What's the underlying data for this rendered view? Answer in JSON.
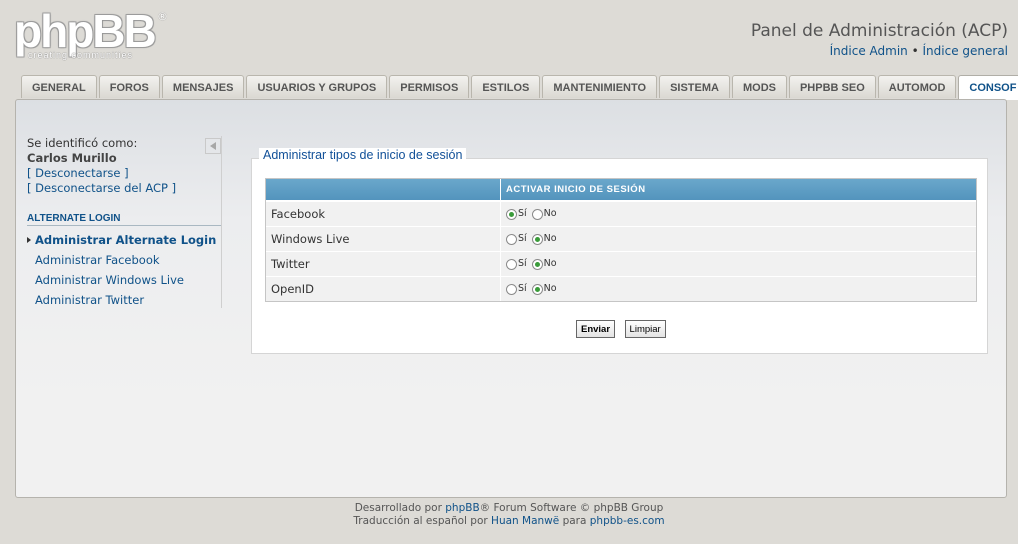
{
  "header": {
    "logo_text": "phpBB",
    "logo_reg": "®",
    "logo_tagline": "creating communities",
    "title": "Panel de Administración (ACP)",
    "link_admin": "Índice Admin",
    "separator": "•",
    "link_general": "Índice general"
  },
  "tabs": [
    {
      "label": "GENERAL"
    },
    {
      "label": "FOROS"
    },
    {
      "label": "MENSAJES"
    },
    {
      "label": "USUARIOS Y GRUPOS"
    },
    {
      "label": "PERMISOS"
    },
    {
      "label": "ESTILOS"
    },
    {
      "label": "MANTENIMIENTO"
    },
    {
      "label": "SISTEMA"
    },
    {
      "label": "MODS"
    },
    {
      "label": "PHPBB SEO"
    },
    {
      "label": "AUTOMOD"
    },
    {
      "label": "CONSOF",
      "active": true
    }
  ],
  "sidebar": {
    "identified_as": "Se identificó como:",
    "username": "Carlos Murillo",
    "logout": "[ Desconectarse ]",
    "logout_acp": "[ Desconectarse del ACP ]",
    "section_title": "ALTERNATE LOGIN",
    "items": [
      {
        "label": "Administrar Alternate Login",
        "active": true
      },
      {
        "label": "Administrar Facebook"
      },
      {
        "label": "Administrar Windows Live"
      },
      {
        "label": "Administrar Twitter"
      }
    ]
  },
  "main": {
    "legend": "Administrar tipos de inicio de sesión",
    "table": {
      "col1_header": "",
      "col2_header": "ACTIVAR INICIO DE SESIÓN",
      "yes_label": "Sí",
      "no_label": "No",
      "rows": [
        {
          "name": "Facebook",
          "enabled": true
        },
        {
          "name": "Windows Live",
          "enabled": false
        },
        {
          "name": "Twitter",
          "enabled": false
        },
        {
          "name": "OpenID",
          "enabled": false
        }
      ]
    },
    "submit_label": "Enviar",
    "reset_label": "Limpiar"
  },
  "footer": {
    "line1_prefix": "Desarrollado por ",
    "line1_link": "phpBB",
    "line1_suffix": "® Forum Software © phpBB Group",
    "line2_prefix": "Traducción al español por ",
    "line2_link1": "Huan Manwë",
    "line2_mid": " para ",
    "line2_link2": "phpbb-es.com"
  },
  "colors": {
    "link": "#105289",
    "table_header": "#5f9fc6",
    "radio_on": "#3a9b3a"
  }
}
